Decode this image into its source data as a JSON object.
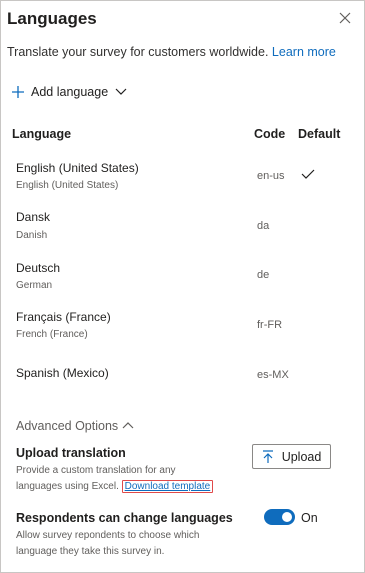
{
  "panel": {
    "title": "Languages",
    "subtitle": "Translate your survey for customers worldwide.",
    "learn_more": "Learn more"
  },
  "toolbar": {
    "add_language_label": "Add language"
  },
  "table": {
    "headers": {
      "language": "Language",
      "code": "Code",
      "default": "Default"
    },
    "rows": [
      {
        "name": "English (United States)",
        "native": "English (United States)",
        "code": "en-us",
        "default": true
      },
      {
        "name": "Dansk",
        "native": "Danish",
        "code": "da",
        "default": false
      },
      {
        "name": "Deutsch",
        "native": "German",
        "code": "de",
        "default": false
      },
      {
        "name": "Français (France)",
        "native": "French (France)",
        "code": "fr-FR",
        "default": false
      },
      {
        "name": "Spanish (Mexico)",
        "native": "",
        "code": "es-MX",
        "default": false
      }
    ]
  },
  "advanced": {
    "label": "Advanced Options",
    "upload": {
      "heading": "Upload translation",
      "desc_line1": "Provide a custom translation for any",
      "desc_line2": "languages using Excel.",
      "download_link": "Download template",
      "button_label": "Upload"
    },
    "respondents": {
      "heading": "Respondents can change languages",
      "desc_line1": "Allow survey repondents to choose which",
      "desc_line2": "language they take this survey in.",
      "toggle_label": "On",
      "toggle_on": true
    }
  },
  "colors": {
    "accent": "#0f6cbd",
    "highlight_border": "#e04a4a"
  },
  "icons": {
    "close": "close-icon",
    "add": "plus-icon",
    "chevron": "chevron-down-icon",
    "check": "checkmark-icon",
    "collapse": "chevron-up-icon",
    "upload": "upload-icon"
  }
}
